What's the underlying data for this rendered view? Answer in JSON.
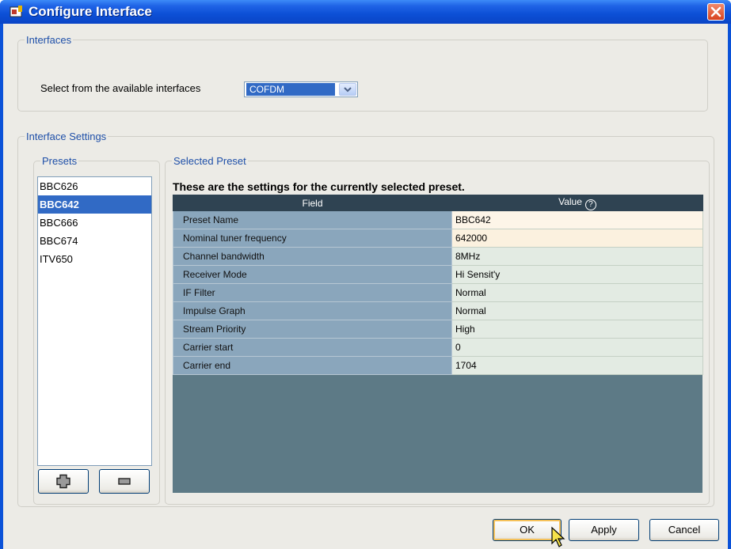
{
  "window": {
    "title": "Configure Interface",
    "icon": "app-icon",
    "close_icon": "close-icon"
  },
  "interfaces": {
    "legend": "Interfaces",
    "select_label": "Select from the available interfaces",
    "selected_value": "COFDM"
  },
  "settings": {
    "legend": "Interface Settings"
  },
  "presets": {
    "legend": "Presets",
    "items": [
      "BBC626",
      "BBC642",
      "BBC666",
      "BBC674",
      "ITV650"
    ],
    "selected": "BBC642",
    "add_icon": "plus-icon",
    "remove_icon": "minus-icon"
  },
  "selected_preset": {
    "legend": "Selected Preset",
    "heading": "These are the settings for the currently selected preset.",
    "columns": {
      "field": "Field",
      "value": "Value"
    },
    "rows": [
      {
        "field": "Preset Name",
        "value": "BBC642"
      },
      {
        "field": "Nominal tuner frequency",
        "value": "642000"
      },
      {
        "field": "Channel bandwidth",
        "value": "8MHz"
      },
      {
        "field": "Receiver Mode",
        "value": "Hi Sensit'y"
      },
      {
        "field": "IF Filter",
        "value": "Normal"
      },
      {
        "field": "Impulse Graph",
        "value": "Normal"
      },
      {
        "field": "Stream Priority",
        "value": "High"
      },
      {
        "field": "Carrier start",
        "value": "0"
      },
      {
        "field": "Carrier end",
        "value": "1704"
      }
    ]
  },
  "buttons": {
    "ok": "OK",
    "apply": "Apply",
    "cancel": "Cancel"
  },
  "colors": {
    "titlebar": "#0c4fd6",
    "selection": "#316ac5",
    "table_header": "#2f4352",
    "table_field_cell": "#8aa6bc",
    "table_empty_area": "#5d7a86"
  }
}
